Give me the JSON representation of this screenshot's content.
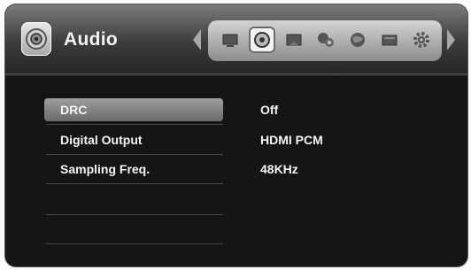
{
  "header": {
    "title": "Audio",
    "icon": "audio-disc-icon",
    "categories": [
      "display-icon",
      "audio-icon",
      "lock-icon",
      "network-icon",
      "globe-icon",
      "folder-icon",
      "gear-icon"
    ]
  },
  "menu": {
    "items": [
      {
        "label": "DRC",
        "value": "Off",
        "selected": true
      },
      {
        "label": "Digital Output",
        "value": "HDMI PCM",
        "selected": false
      },
      {
        "label": "Sampling Freq.",
        "value": "48KHz",
        "selected": false
      },
      {
        "label": "",
        "value": "",
        "selected": false
      },
      {
        "label": "",
        "value": "",
        "selected": false
      }
    ]
  },
  "colors": {
    "background": "#151515",
    "header": "#4a4a4a",
    "selection": "#8a8a8a",
    "text": "#f4f4f4"
  }
}
